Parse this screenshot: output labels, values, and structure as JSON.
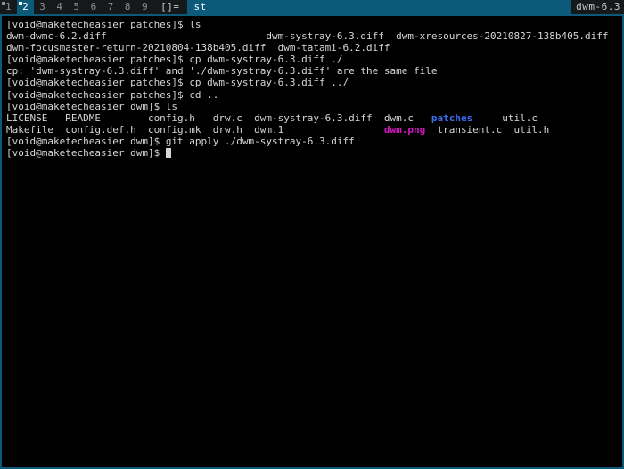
{
  "bar": {
    "tags": [
      {
        "label": "1",
        "selected": false,
        "has_indicator": true
      },
      {
        "label": "2",
        "selected": true,
        "has_indicator": true
      },
      {
        "label": "3",
        "selected": false,
        "has_indicator": false
      },
      {
        "label": "4",
        "selected": false,
        "has_indicator": false
      },
      {
        "label": "5",
        "selected": false,
        "has_indicator": false
      },
      {
        "label": "6",
        "selected": false,
        "has_indicator": false
      },
      {
        "label": "7",
        "selected": false,
        "has_indicator": false
      },
      {
        "label": "8",
        "selected": false,
        "has_indicator": false
      },
      {
        "label": "9",
        "selected": false,
        "has_indicator": false
      }
    ],
    "layout_symbol": "[]=",
    "window_title": "st",
    "status_text": "dwm-6.3"
  },
  "colors": {
    "bar_selected_bg": "#0b5a7a",
    "bar_normal_bg": "#15191c",
    "bar_normal_fg": "#8a9399",
    "bar_selected_fg": "#ffffff",
    "terminal_bg": "#000000",
    "terminal_fg": "#d6d6d6",
    "terminal_border": "#0b5a7a",
    "dir_color": "#3b6ef0",
    "image_color": "#d616c6"
  },
  "terminal": {
    "prompt_patches": "[void@maketecheasier patches]$ ",
    "prompt_dwm": "[void@maketecheasier dwm]$ ",
    "lines": [
      {
        "type": "command",
        "prompt": "[void@maketecheasier patches]$ ",
        "command": "ls"
      },
      {
        "type": "plain",
        "text": "dwm-dwmc-6.2.diff                           dwm-systray-6.3.diff  dwm-xresources-20210827-138b405.diff"
      },
      {
        "type": "plain",
        "text": "dwm-focusmaster-return-20210804-138b405.diff  dwm-tatami-6.2.diff"
      },
      {
        "type": "command",
        "prompt": "[void@maketecheasier patches]$ ",
        "command": "cp dwm-systray-6.3.diff ./"
      },
      {
        "type": "plain",
        "text": "cp: 'dwm-systray-6.3.diff' and './dwm-systray-6.3.diff' are the same file"
      },
      {
        "type": "command",
        "prompt": "[void@maketecheasier patches]$ ",
        "command": "cp dwm-systray-6.3.diff ../"
      },
      {
        "type": "command",
        "prompt": "[void@maketecheasier patches]$ ",
        "command": "cd .."
      },
      {
        "type": "command",
        "prompt": "[void@maketecheasier dwm]$ ",
        "command": "ls"
      },
      {
        "type": "ls",
        "segments": [
          {
            "text": "LICENSE   README        config.h   drw.c  dwm-systray-6.3.diff  dwm.c   ",
            "color": "default"
          },
          {
            "text": "patches",
            "color": "dir"
          },
          {
            "text": "     util.c",
            "color": "default"
          }
        ]
      },
      {
        "type": "ls",
        "segments": [
          {
            "text": "Makefile  config.def.h  config.mk  drw.h  dwm.1                 ",
            "color": "default"
          },
          {
            "text": "dwm.png",
            "color": "image"
          },
          {
            "text": "  transient.c  util.h",
            "color": "default"
          }
        ]
      },
      {
        "type": "command",
        "prompt": "[void@maketecheasier dwm]$ ",
        "command": "git apply ./dwm-systray-6.3.diff"
      },
      {
        "type": "cursor-line",
        "prompt": "[void@maketecheasier dwm]$ ",
        "command": ""
      }
    ]
  }
}
